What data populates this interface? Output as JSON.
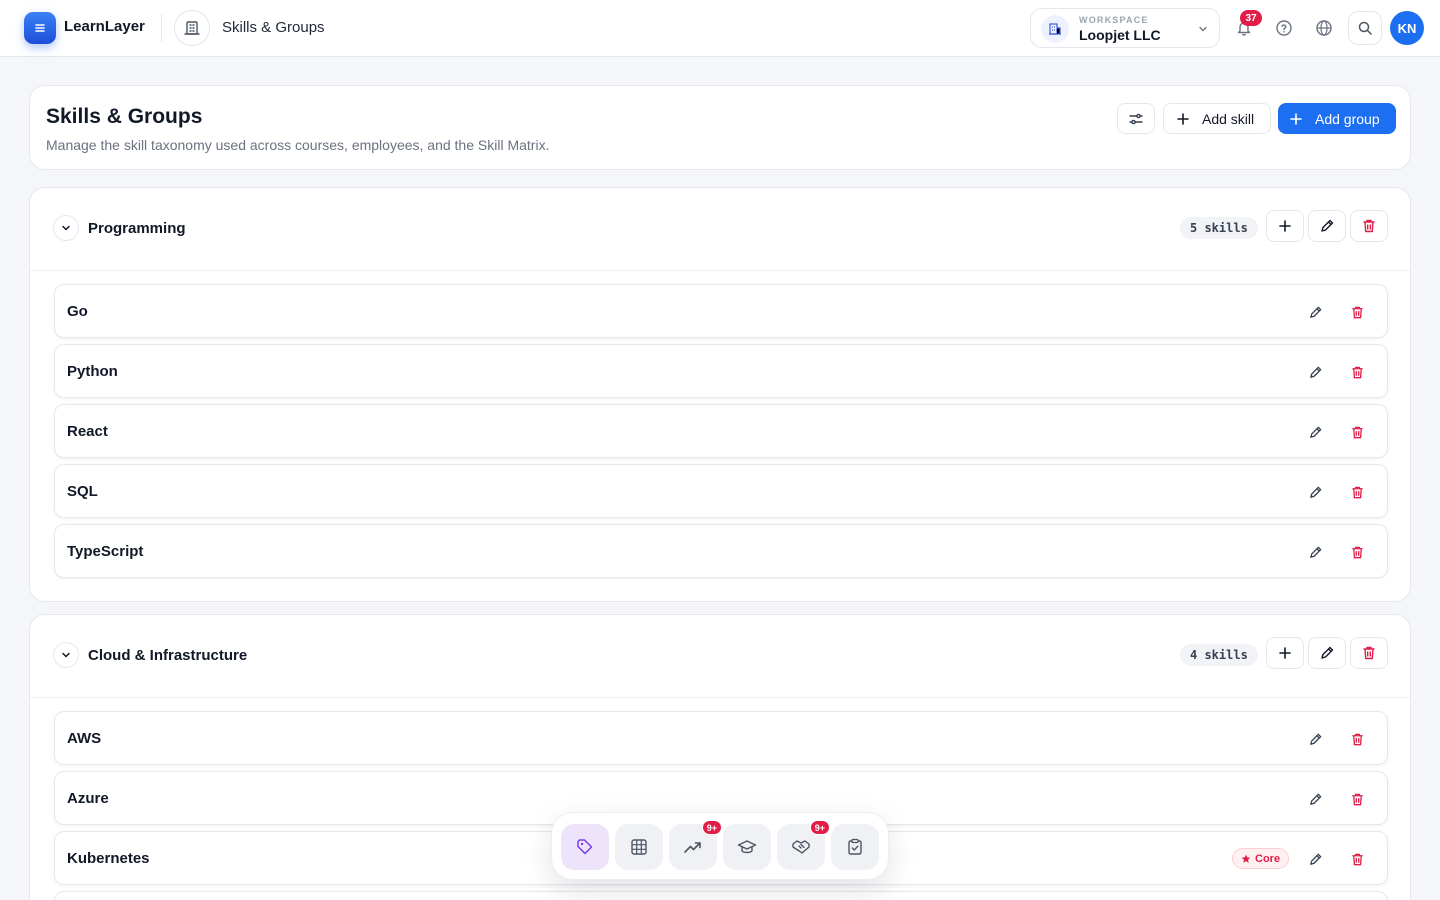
{
  "app": {
    "name": "LearnLayer"
  },
  "breadcrumb": {
    "title": "Skills & Groups"
  },
  "workspace": {
    "label": "WORKSPACE",
    "name": "Loopjet LLC"
  },
  "notifications": {
    "count": "37"
  },
  "user": {
    "initials": "KN"
  },
  "page": {
    "title": "Skills & Groups",
    "subtitle": "Manage the skill taxonomy used across courses, employees, and the Skill Matrix.",
    "add_skill_label": "Add skill",
    "add_group_label": "Add group"
  },
  "groups": [
    {
      "name": "Programming",
      "count_label": "5 skills",
      "skills": [
        {
          "name": "Go"
        },
        {
          "name": "Python"
        },
        {
          "name": "React"
        },
        {
          "name": "SQL"
        },
        {
          "name": "TypeScript"
        }
      ]
    },
    {
      "name": "Cloud & Infrastructure",
      "count_label": "4 skills",
      "skills": [
        {
          "name": "AWS"
        },
        {
          "name": "Azure"
        },
        {
          "name": "Kubernetes",
          "badge": "Core"
        }
      ]
    }
  ],
  "dock": {
    "items": [
      {
        "icon": "tag-icon",
        "active": true
      },
      {
        "icon": "grid-icon"
      },
      {
        "icon": "trending-up-icon",
        "badge": "9+"
      },
      {
        "icon": "graduation-cap-icon"
      },
      {
        "icon": "handshake-icon",
        "badge": "9+"
      },
      {
        "icon": "clipboard-check-icon"
      }
    ]
  },
  "colors": {
    "primary": "#1d6ff2",
    "danger": "#e11d48",
    "background": "#f5f6fa"
  }
}
